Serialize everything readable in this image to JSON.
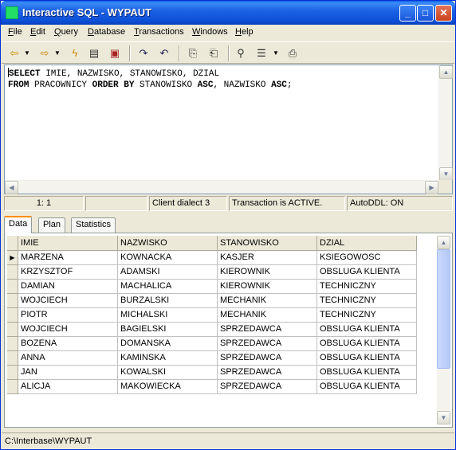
{
  "window": {
    "title": "Interactive SQL - WYPAUT",
    "min_label": "_",
    "max_label": "□",
    "close_label": "✕"
  },
  "menu": {
    "items": [
      {
        "u": "F",
        "rest": "ile"
      },
      {
        "u": "E",
        "rest": "dit"
      },
      {
        "u": "Q",
        "rest": "uery"
      },
      {
        "u": "D",
        "rest": "atabase"
      },
      {
        "u": "T",
        "rest": "ransactions"
      },
      {
        "u": "W",
        "rest": "indows"
      },
      {
        "u": "H",
        "rest": "elp"
      }
    ]
  },
  "toolbar": {
    "icons": [
      "prev-query-icon",
      "next-query-icon",
      "execute-icon",
      "notepad-icon",
      "load-script-icon",
      "commit-icon",
      "rollback-icon",
      "copy-icon",
      "paste-icon",
      "find-icon",
      "view-icon",
      "print-icon"
    ]
  },
  "editor": {
    "line1_kw1": "SELECT",
    "line1_rest": " IMIE, NAZWISKO, STANOWISKO, DZIAL",
    "line2_kw1": "FROM",
    "line2_mid1": " PRACOWNICY ",
    "line2_kw2": "ORDER BY",
    "line2_mid2": " STANOWISKO ",
    "line2_kw3": "ASC",
    "line2_mid3": ", NAZWISKO ",
    "line2_kw4": "ASC",
    "line2_end": ";"
  },
  "status": {
    "position": "1:  1",
    "empty": "",
    "dialect": "Client dialect 3",
    "transaction": "Transaction is ACTIVE.",
    "autoddl": "AutoDDL: ON"
  },
  "tabs": {
    "data": "Data",
    "plan": "Plan",
    "statistics": "Statistics"
  },
  "grid": {
    "columns": [
      "IMIE",
      "NAZWISKO",
      "STANOWISKO",
      "DZIAL"
    ],
    "rows": [
      [
        "MARZENA",
        "KOWNACKA",
        "KASJER",
        "KSIEGOWOSC"
      ],
      [
        "KRZYSZTOF",
        "ADAMSKI",
        "KIEROWNIK",
        "OBSLUGA KLIENTA"
      ],
      [
        "DAMIAN",
        "MACHALICA",
        "KIEROWNIK",
        "TECHNICZNY"
      ],
      [
        "WOJCIECH",
        "BURZALSKI",
        "MECHANIK",
        "TECHNICZNY"
      ],
      [
        "PIOTR",
        "MICHALSKI",
        "MECHANIK",
        "TECHNICZNY"
      ],
      [
        "WOJCIECH",
        "BAGIELSKI",
        "SPRZEDAWCA",
        "OBSLUGA KLIENTA"
      ],
      [
        "BOZENA",
        "DOMANSKA",
        "SPRZEDAWCA",
        "OBSLUGA KLIENTA"
      ],
      [
        "ANNA",
        "KAMINSKA",
        "SPRZEDAWCA",
        "OBSLUGA KLIENTA"
      ],
      [
        "JAN",
        "KOWALSKI",
        "SPRZEDAWCA",
        "OBSLUGA KLIENTA"
      ],
      [
        "ALICJA",
        "MAKOWIECKA",
        "SPRZEDAWCA",
        "OBSLUGA KLIENTA"
      ]
    ],
    "current_row_marker": "▶"
  },
  "statusbar": {
    "path": "C:\\Interbase\\WYPAUT"
  }
}
